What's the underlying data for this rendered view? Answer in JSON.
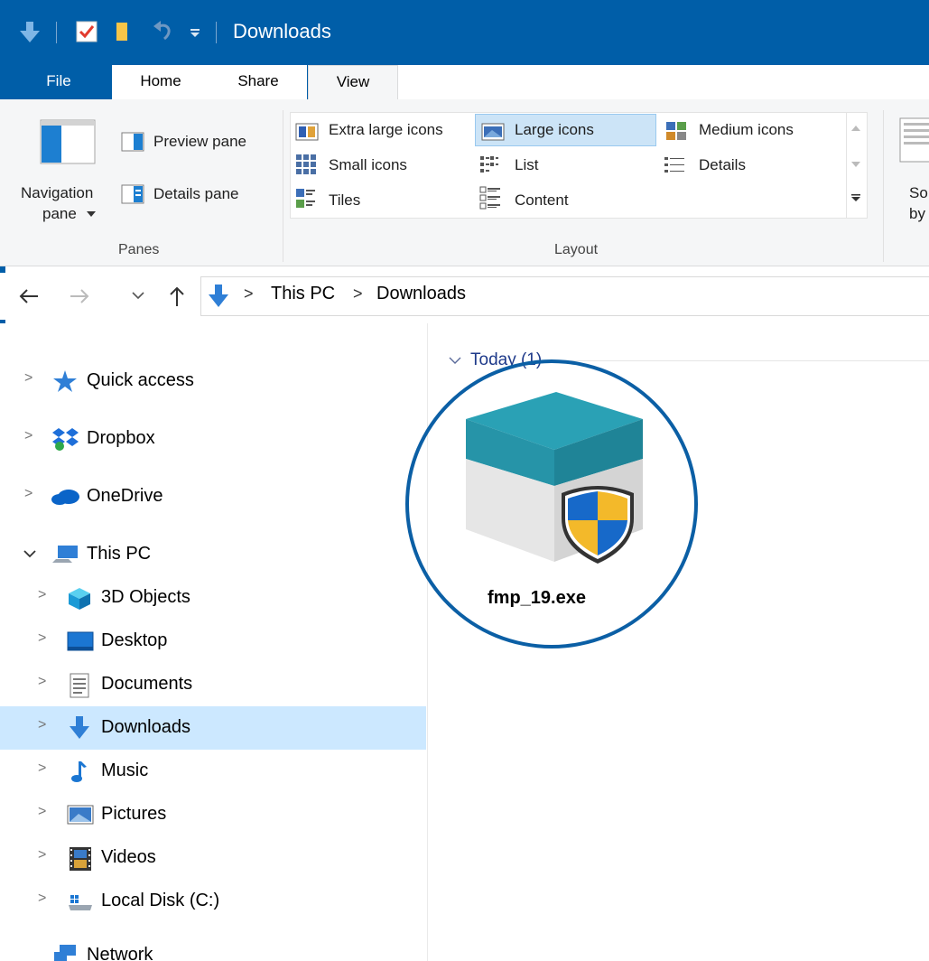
{
  "window": {
    "title": "Downloads"
  },
  "ribbon": {
    "tabs": [
      {
        "label": "File"
      },
      {
        "label": "Home"
      },
      {
        "label": "Share"
      },
      {
        "label": "View"
      }
    ],
    "panes": {
      "navigation_pane_line1": "Navigation",
      "navigation_pane_line2": "pane",
      "preview_pane": "Preview pane",
      "details_pane": "Details pane",
      "group_label": "Panes"
    },
    "layout": {
      "extra_large_icons": "Extra large icons",
      "large_icons": "Large icons",
      "medium_icons": "Medium icons",
      "small_icons": "Small icons",
      "list": "List",
      "details": "Details",
      "tiles": "Tiles",
      "content": "Content",
      "group_label": "Layout"
    },
    "sort": {
      "line1": "So",
      "line2": "by"
    }
  },
  "address": {
    "crumbs": [
      "This PC",
      "Downloads"
    ]
  },
  "nav": {
    "items": [
      {
        "label": "Quick access"
      },
      {
        "label": "Dropbox"
      },
      {
        "label": "OneDrive"
      },
      {
        "label": "This PC"
      },
      {
        "label": "3D Objects"
      },
      {
        "label": "Desktop"
      },
      {
        "label": "Documents"
      },
      {
        "label": "Downloads"
      },
      {
        "label": "Music"
      },
      {
        "label": "Pictures"
      },
      {
        "label": "Videos"
      },
      {
        "label": "Local Disk (C:)"
      },
      {
        "label": "Network"
      }
    ]
  },
  "content": {
    "group_header": "Today (1)",
    "files": [
      {
        "name": "fmp_19.exe"
      }
    ]
  },
  "colors": {
    "accent": "#005ea8",
    "selection": "#cce8ff",
    "highlight_ring": "#0b5fa5"
  }
}
